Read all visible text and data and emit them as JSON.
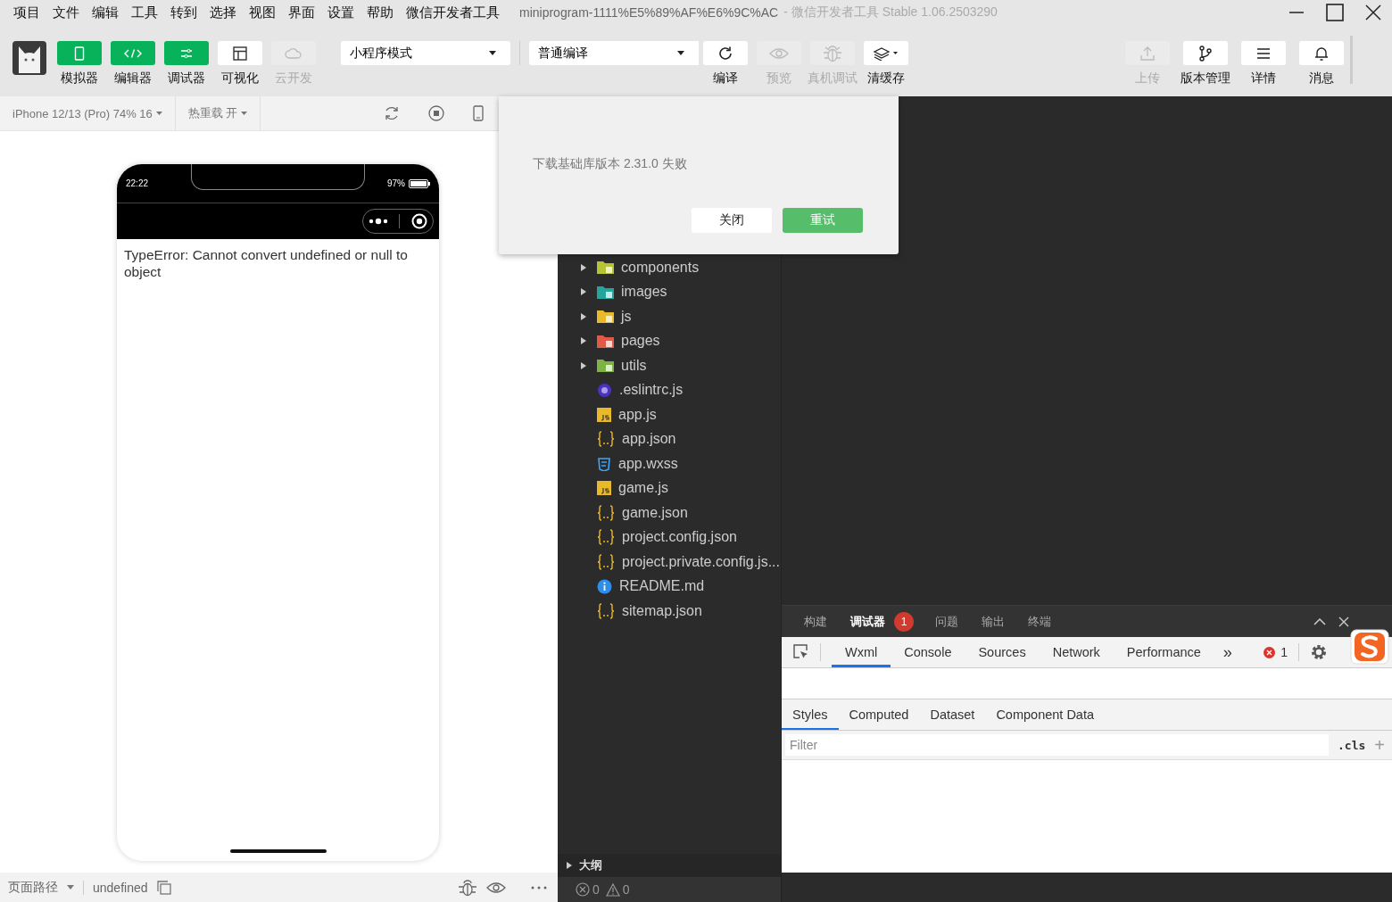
{
  "menu_bar": {
    "items": [
      "项目",
      "文件",
      "编辑",
      "工具",
      "转到",
      "选择",
      "视图",
      "界面",
      "设置",
      "帮助",
      "微信开发者工具"
    ],
    "project_title": "miniprogram-1111%E5%89%AF%E6%9C%AC",
    "app_title": "- 微信开发者工具 Stable 1.06.2503290"
  },
  "toolbar": {
    "view_toggles": [
      {
        "label": "模拟器",
        "on": true,
        "disabled": false
      },
      {
        "label": "编辑器",
        "on": true,
        "disabled": false
      },
      {
        "label": "调试器",
        "on": true,
        "disabled": false
      },
      {
        "label": "可视化",
        "on": false,
        "disabled": false
      },
      {
        "label": "云开发",
        "on": false,
        "disabled": true
      }
    ],
    "mode_select": {
      "value": "小程序模式"
    },
    "compile_select": {
      "value": "普通编译"
    },
    "actions": [
      {
        "label": "编译",
        "disabled": false
      },
      {
        "label": "预览",
        "disabled": true
      },
      {
        "label": "真机调试",
        "disabled": true
      },
      {
        "label": "清缓存",
        "disabled": false
      }
    ],
    "right_actions": [
      {
        "label": "上传",
        "disabled": true
      },
      {
        "label": "版本管理",
        "disabled": false
      },
      {
        "label": "详情",
        "disabled": false
      },
      {
        "label": "消息",
        "disabled": false
      }
    ]
  },
  "simulator": {
    "device": "iPhone 12/13 (Pro) 74% 16",
    "hot_reload": "热重载 开",
    "phone": {
      "time": "22:22",
      "battery": "97%",
      "error_text": "TypeError: Cannot convert undefined or null to object"
    },
    "page_path_label": "页面路径",
    "page_path": "undefined"
  },
  "dialog": {
    "message": "下载基础库版本 2.31.0 失败",
    "buttons": [
      {
        "label": "关闭",
        "kind": "secondary"
      },
      {
        "label": "重试",
        "kind": "primary"
      }
    ]
  },
  "file_tree": {
    "items": [
      {
        "name": "components",
        "kind": "folder",
        "color": "#b5c334",
        "expanded": false
      },
      {
        "name": "images",
        "kind": "folder",
        "color": "#22a59b",
        "expanded": false
      },
      {
        "name": "js",
        "kind": "folder",
        "color": "#e8b928",
        "expanded": false
      },
      {
        "name": "pages",
        "kind": "folder",
        "color": "#e05a47",
        "expanded": false
      },
      {
        "name": "utils",
        "kind": "folder",
        "color": "#7cb342",
        "expanded": false
      },
      {
        "name": ".eslintrc.js",
        "kind": "eslint"
      },
      {
        "name": "app.js",
        "kind": "js"
      },
      {
        "name": "app.json",
        "kind": "json"
      },
      {
        "name": "app.wxss",
        "kind": "css"
      },
      {
        "name": "game.js",
        "kind": "js"
      },
      {
        "name": "game.json",
        "kind": "json"
      },
      {
        "name": "project.config.json",
        "kind": "json"
      },
      {
        "name": "project.private.config.js...",
        "kind": "json"
      },
      {
        "name": "README.md",
        "kind": "info"
      },
      {
        "name": "sitemap.json",
        "kind": "json"
      }
    ]
  },
  "outline": {
    "label": "大纲",
    "expanded": false
  },
  "problems": {
    "errors": "0",
    "warnings": "0"
  },
  "panel": {
    "tabs": [
      {
        "label": "构建",
        "selected": false
      },
      {
        "label": "调试器",
        "selected": true,
        "badge": "1"
      },
      {
        "label": "问题",
        "selected": false
      },
      {
        "label": "输出",
        "selected": false
      },
      {
        "label": "终端",
        "selected": false
      }
    ]
  },
  "devtools": {
    "tabs": [
      {
        "label": "Wxml",
        "selected": true
      },
      {
        "label": "Console",
        "selected": false
      },
      {
        "label": "Sources",
        "selected": false
      },
      {
        "label": "Network",
        "selected": false
      },
      {
        "label": "Performance",
        "selected": false
      }
    ],
    "more_tabs": "»",
    "error_count": "1",
    "style_tabs": [
      {
        "label": "Styles",
        "selected": true
      },
      {
        "label": "Computed",
        "selected": false
      },
      {
        "label": "Dataset",
        "selected": false
      },
      {
        "label": "Component Data",
        "selected": false
      }
    ],
    "filter": {
      "placeholder": "Filter"
    },
    "cls": ".cls",
    "add": "+"
  }
}
